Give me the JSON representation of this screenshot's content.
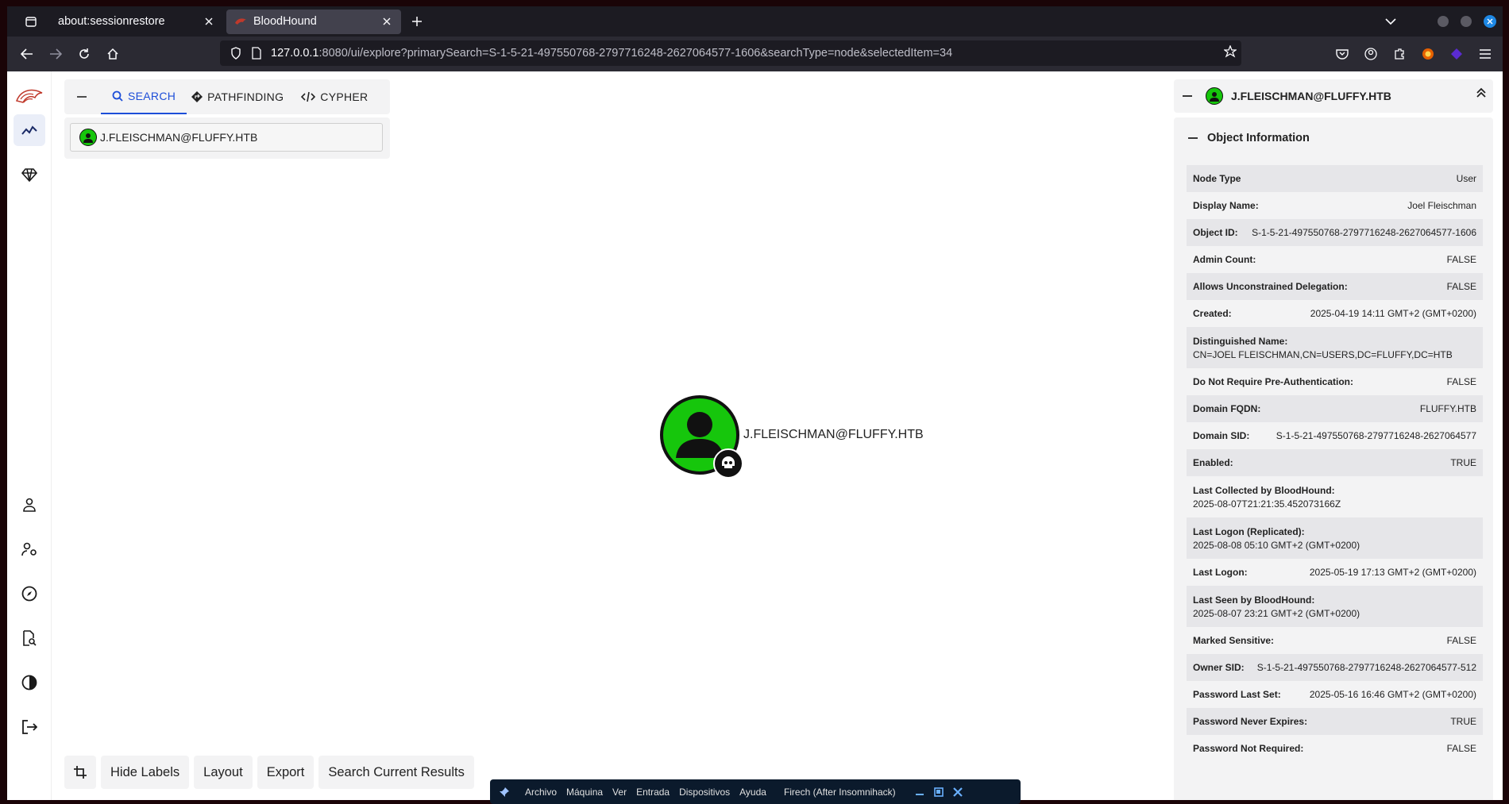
{
  "browser": {
    "tabs": [
      {
        "title": "about:sessionrestore"
      },
      {
        "title": "BloodHound"
      }
    ],
    "url_host": "127.0.0.1",
    "url_rest": ":8080/ui/explore?primarySearch=S-1-5-21-497550768-2797716248-2627064577-1606&searchType=node&selectedItem=34"
  },
  "search_tabs": {
    "search": "SEARCH",
    "pathfinding": "PATHFINDING",
    "cypher": "CYPHER"
  },
  "search": {
    "value": "J.FLEISCHMAN@FLUFFY.HTB"
  },
  "graph": {
    "node_label": "J.FLEISCHMAN@FLUFFY.HTB"
  },
  "bottom_buttons": {
    "hide_labels": "Hide Labels",
    "layout": "Layout",
    "export": "Export",
    "search_results": "Search Current Results"
  },
  "panel": {
    "title": "J.FLEISCHMAN@FLUFFY.HTB",
    "section_title": "Object Information",
    "rows": [
      {
        "k": "Node Type",
        "v": "User"
      },
      {
        "k": "Display Name:",
        "v": "Joel Fleischman"
      },
      {
        "k": "Object ID:",
        "v": "S-1-5-21-497550768-2797716248-2627064577-1606"
      },
      {
        "k": "Admin Count:",
        "v": "FALSE"
      },
      {
        "k": "Allows Unconstrained Delegation:",
        "v": "FALSE"
      },
      {
        "k": "Created:",
        "v": "2025-04-19 14:11 GMT+2 (GMT+0200)"
      },
      {
        "k": "Distinguished Name:",
        "v": "CN=JOEL FLEISCHMAN,CN=USERS,DC=FLUFFY,DC=HTB"
      },
      {
        "k": "Do Not Require Pre-Authentication:",
        "v": "FALSE"
      },
      {
        "k": "Domain FQDN:",
        "v": "FLUFFY.HTB"
      },
      {
        "k": "Domain SID:",
        "v": "S-1-5-21-497550768-2797716248-2627064577"
      },
      {
        "k": "Enabled:",
        "v": "TRUE"
      },
      {
        "k": "Last Collected by BloodHound:",
        "v": "2025-08-07T21:21:35.452073166Z"
      },
      {
        "k": "Last Logon (Replicated):",
        "v": "2025-08-08 05:10 GMT+2 (GMT+0200)"
      },
      {
        "k": "Last Logon:",
        "v": "2025-05-19 17:13 GMT+2 (GMT+0200)"
      },
      {
        "k": "Last Seen by BloodHound:",
        "v": "2025-08-07 23:21 GMT+2 (GMT+0200)"
      },
      {
        "k": "Marked Sensitive:",
        "v": "FALSE"
      },
      {
        "k": "Owner SID:",
        "v": "S-1-5-21-497550768-2797716248-2627064577-512"
      },
      {
        "k": "Password Last Set:",
        "v": "2025-05-16 16:46 GMT+2 (GMT+0200)"
      },
      {
        "k": "Password Never Expires:",
        "v": "TRUE"
      },
      {
        "k": "Password Not Required:",
        "v": "FALSE"
      }
    ]
  },
  "vbox_menu": {
    "archivo": "Archivo",
    "maquina": "Máquina",
    "ver": "Ver",
    "entrada": "Entrada",
    "dispositivos": "Dispositivos",
    "ayuda": "Ayuda",
    "vm_name": "Firech (After Insomnihack)"
  },
  "colors": {
    "accent": "#1d4ed8",
    "node_user": "#16c60c"
  }
}
